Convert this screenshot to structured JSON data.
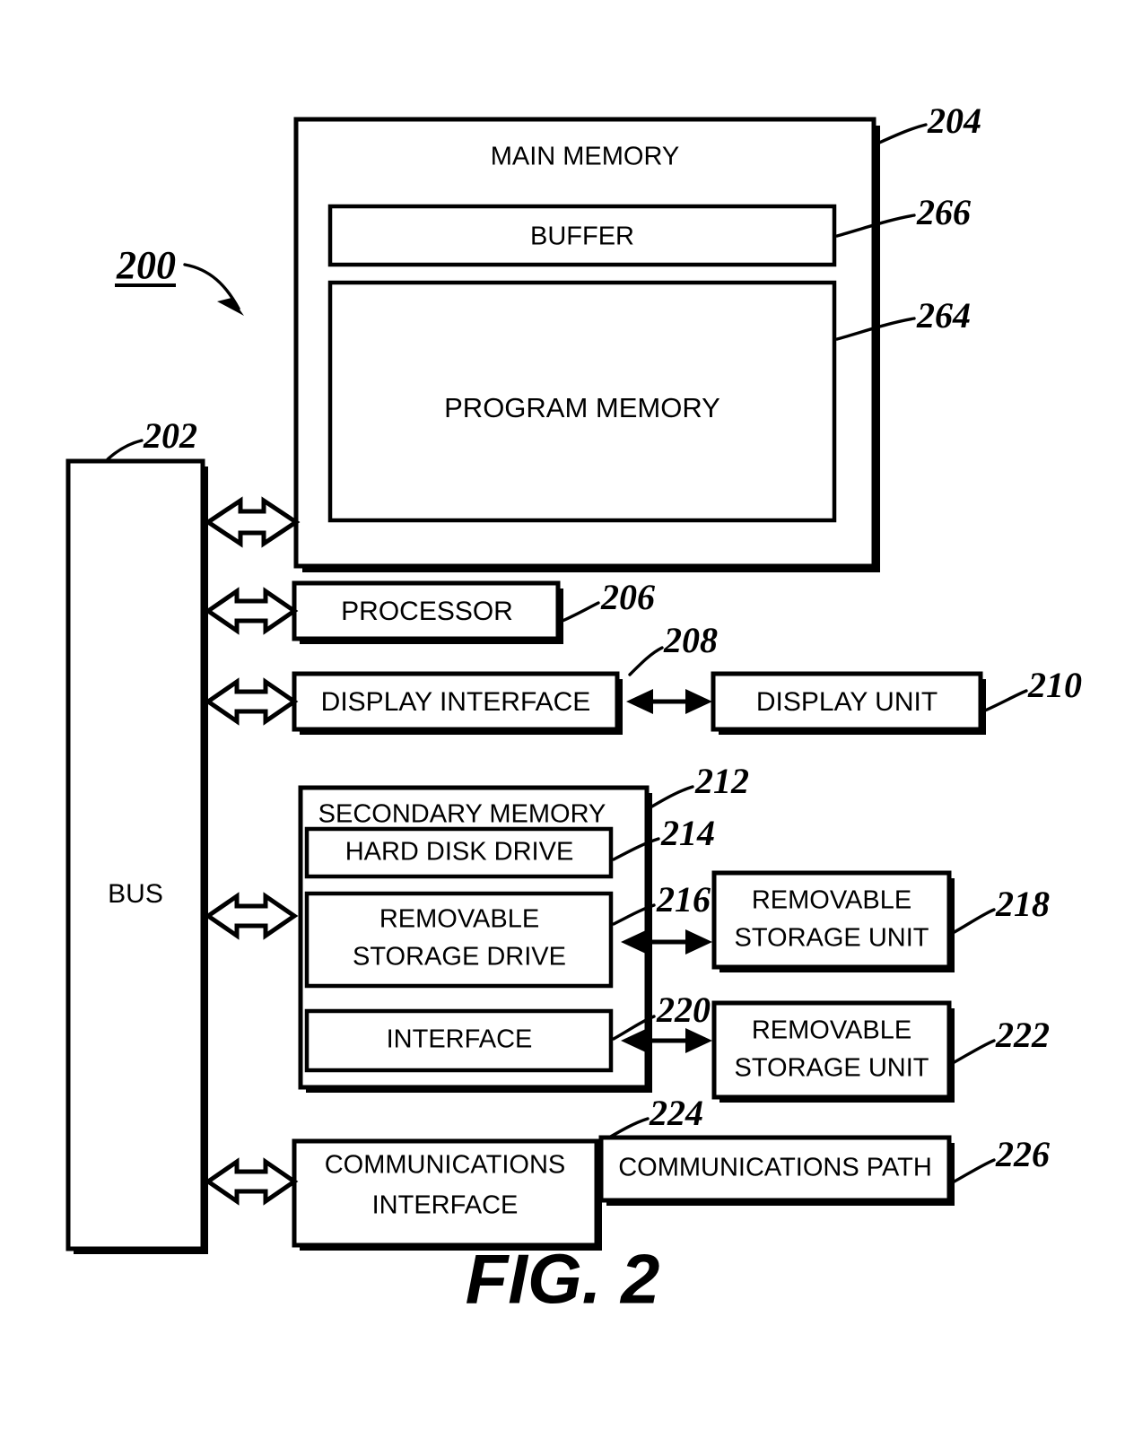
{
  "figure": {
    "caption": "FIG. 2",
    "system_ref": "200"
  },
  "blocks": {
    "bus": {
      "label": "BUS",
      "ref": "202"
    },
    "main_memory": {
      "label": "MAIN MEMORY",
      "ref": "204"
    },
    "buffer": {
      "label": "BUFFER",
      "ref": "266"
    },
    "program_memory": {
      "label": "PROGRAM MEMORY",
      "ref": "264"
    },
    "processor": {
      "label": "PROCESSOR",
      "ref": "206"
    },
    "display_interface": {
      "label": "DISPLAY INTERFACE",
      "ref": "208"
    },
    "display_unit": {
      "label": "DISPLAY UNIT",
      "ref": "210"
    },
    "secondary_memory": {
      "label": "SECONDARY MEMORY",
      "ref": "212"
    },
    "hard_disk_drive": {
      "label": "HARD DISK DRIVE",
      "ref": "214"
    },
    "removable_storage_drive": {
      "label_line1": "REMOVABLE",
      "label_line2": "STORAGE DRIVE",
      "ref": "216"
    },
    "removable_storage_unit_1": {
      "label_line1": "REMOVABLE",
      "label_line2": "STORAGE UNIT",
      "ref": "218"
    },
    "interface": {
      "label": "INTERFACE",
      "ref": "220"
    },
    "removable_storage_unit_2": {
      "label_line1": "REMOVABLE",
      "label_line2": "STORAGE UNIT",
      "ref": "222"
    },
    "communications_interface": {
      "label_line1": "COMMUNICATIONS",
      "label_line2": "INTERFACE",
      "ref": "224"
    },
    "communications_path": {
      "label": "COMMUNICATIONS PATH",
      "ref": "226"
    }
  },
  "colors": {
    "ink": "#000000",
    "paper": "#ffffff"
  }
}
